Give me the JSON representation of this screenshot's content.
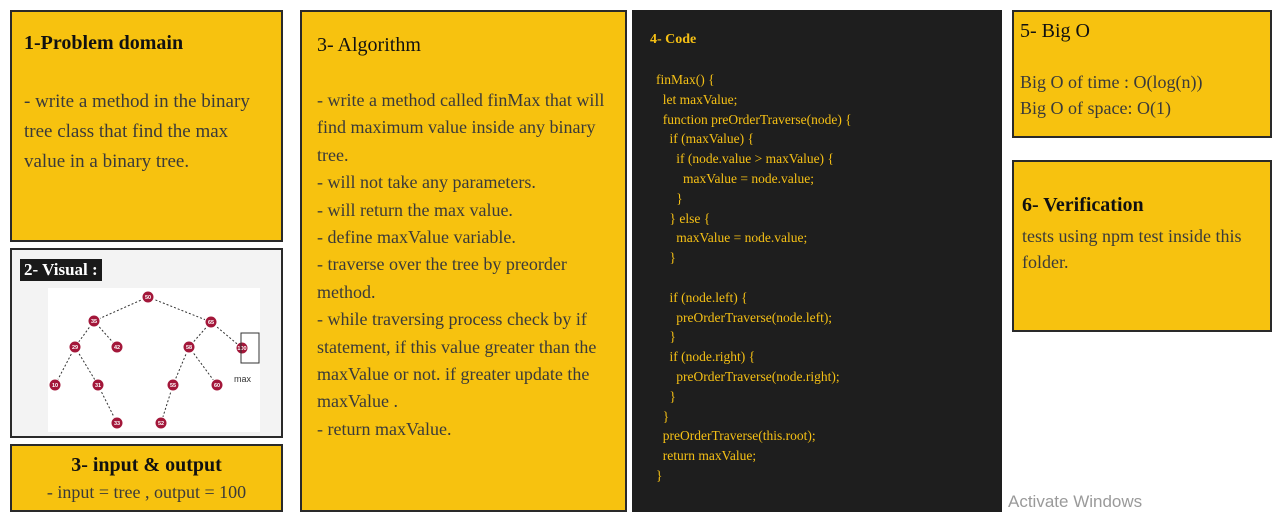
{
  "problem": {
    "title": "1-Problem domain",
    "text": "- write a method in the binary tree class that find the max value in a binary tree."
  },
  "visual": {
    "title": "2- Visual :",
    "nodes": [
      "50",
      "35",
      "65",
      "29",
      "42",
      "58",
      "100",
      "10",
      "31",
      "55",
      "60",
      "33",
      "52"
    ],
    "annotation": "max"
  },
  "io": {
    "title": "3- input & output",
    "text": "- input = tree , output = 100"
  },
  "algorithm": {
    "title": "3- Algorithm",
    "lines": [
      "- write a method called finMax that will find maximum value inside any binary tree.",
      "- will not take any parameters.",
      "- will return the max value.",
      "- define maxValue variable.",
      "- traverse over the tree by preorder method.",
      "- while traversing process check by if statement, if this value greater than the maxValue or not. if greater update the maxValue .",
      "- return maxValue."
    ]
  },
  "code": {
    "title": "4- Code",
    "source": "finMax() {\n  let maxValue;\n  function preOrderTraverse(node) {\n    if (maxValue) {\n      if (node.value > maxValue) {\n        maxValue = node.value;\n      }\n    } else {\n      maxValue = node.value;\n    }\n\n    if (node.left) {\n      preOrderTraverse(node.left);\n    }\n    if (node.right) {\n      preOrderTraverse(node.right);\n    }\n  }\n  preOrderTraverse(this.root);\n  return maxValue;\n}"
  },
  "bigo": {
    "title": "5- Big O",
    "time": "Big O of time : O(log(n))",
    "space": "Big O of space: O(1)"
  },
  "verification": {
    "title": "6- Verification",
    "text": "tests using npm test inside this folder."
  },
  "watermark": "Activate Windows"
}
